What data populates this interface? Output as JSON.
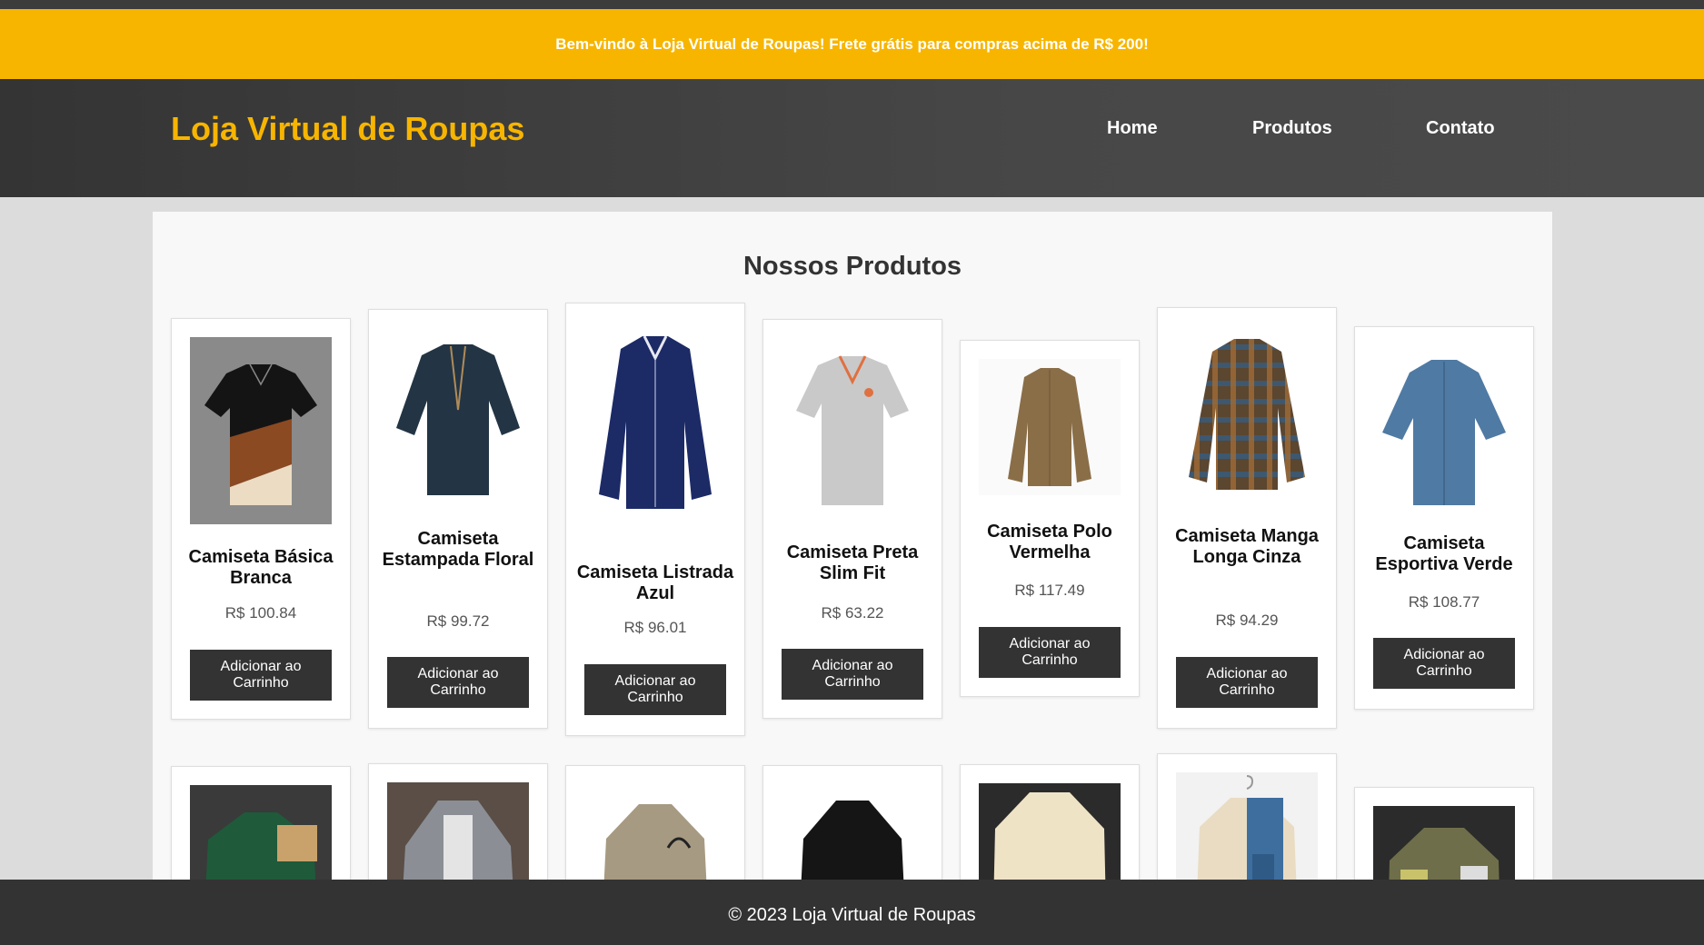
{
  "promo": {
    "text": "Bem-vindo à Loja Virtual de Roupas! Frete grátis para compras acima de R$ 200!"
  },
  "header": {
    "brand": "Loja Virtual de Roupas",
    "nav": [
      "Home",
      "Produtos",
      "Contato"
    ]
  },
  "main": {
    "title": "Nossos Produtos",
    "products": [
      {
        "name": "Camiseta Básica Branca",
        "price": "R$ 100.84",
        "button": "Adicionar ao Carrinho"
      },
      {
        "name": "Camiseta Estampada Floral",
        "price": "R$ 99.72",
        "button": "Adicionar ao Carrinho"
      },
      {
        "name": "Camiseta Listrada Azul",
        "price": "R$ 96.01",
        "button": "Adicionar ao Carrinho"
      },
      {
        "name": "Camiseta Preta Slim Fit",
        "price": "R$ 63.22",
        "button": "Adicionar ao Carrinho"
      },
      {
        "name": "Camiseta Polo Vermelha",
        "price": "R$ 117.49",
        "button": "Adicionar ao Carrinho"
      },
      {
        "name": "Camiseta Manga Longa Cinza",
        "price": "R$ 94.29",
        "button": "Adicionar ao Carrinho"
      },
      {
        "name": "Camiseta Esportiva Verde",
        "price": "R$ 108.77",
        "button": "Adicionar ao Carrinho"
      }
    ]
  },
  "footer": {
    "text": "© 2023 Loja Virtual de Roupas"
  },
  "colors": {
    "accent": "#f7b500",
    "header_bg": "#3c3c3c",
    "button_bg": "#333333",
    "footer_bg": "#333333"
  }
}
